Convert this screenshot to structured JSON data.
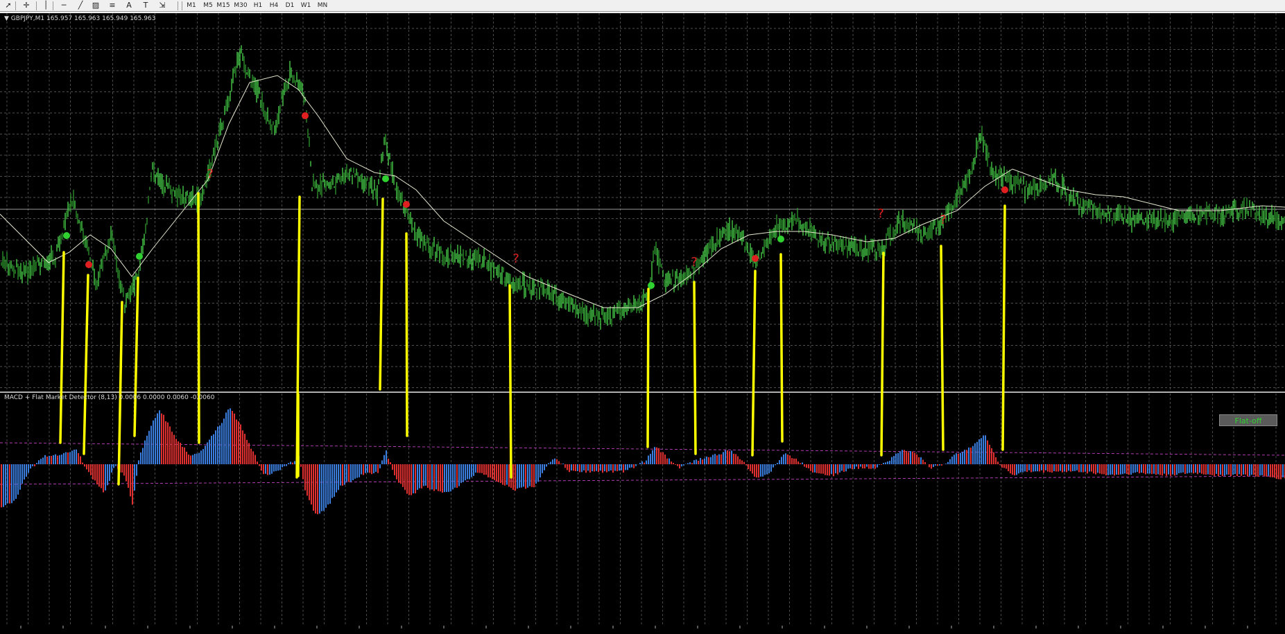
{
  "toolbar": {
    "tools": [
      {
        "icon": "cursor-icon",
        "glyph": "➚"
      },
      {
        "icon": "crosshair-icon",
        "glyph": "✛"
      },
      {
        "icon": "vertical-line-icon",
        "glyph": "│"
      },
      {
        "icon": "horizontal-line-icon",
        "glyph": "─"
      },
      {
        "icon": "trendline-icon",
        "glyph": "╱"
      },
      {
        "icon": "channel-icon",
        "glyph": "▨"
      },
      {
        "icon": "fibonacci-icon",
        "glyph": "≡"
      },
      {
        "icon": "text-icon",
        "glyph": "A"
      },
      {
        "icon": "text-label-icon",
        "glyph": "T"
      },
      {
        "icon": "arrows-icon",
        "glyph": "⇲"
      }
    ],
    "timeframes": [
      "M1",
      "M5",
      "M15",
      "M30",
      "H1",
      "H4",
      "D1",
      "W1",
      "MN"
    ]
  },
  "chart": {
    "header": "GBPJPY,M1  165.957 165.963 165.949 165.963",
    "colors": {
      "background": "#000000",
      "grid": "#6a6a6a",
      "bull": "#4cd94c",
      "ma": "#e8e8d0",
      "yellow": "#ffff00",
      "hist_red": "#e03030",
      "hist_blue": "#3a7fe0",
      "signal_dots_green": "#30d030",
      "signal_dots_red": "#e02020",
      "level_line": "#c040c0"
    },
    "question_mark": "?"
  },
  "indicator": {
    "label": "MACD + Flat Market Detector (8,13) 0.0006 0.0000 0.0060 -0.0060",
    "flat_button": "Flat-off"
  }
}
